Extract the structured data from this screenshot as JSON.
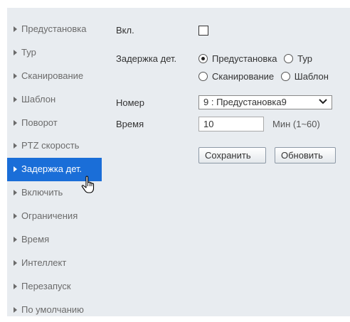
{
  "sidebar": {
    "items": [
      {
        "label": "Предустановка"
      },
      {
        "label": "Тур"
      },
      {
        "label": "Сканирование"
      },
      {
        "label": "Шаблон"
      },
      {
        "label": "Поворот"
      },
      {
        "label": "PTZ скорость"
      },
      {
        "label": "Задержка дет.",
        "active": true
      },
      {
        "label": "Включить"
      },
      {
        "label": "Ограничения"
      },
      {
        "label": "Время"
      },
      {
        "label": "Интеллект"
      },
      {
        "label": "Перезапуск"
      },
      {
        "label": "По умолчанию"
      }
    ],
    "active_color": "#1a6ed8"
  },
  "form": {
    "enable_label": "Вкл.",
    "enable_checked": false,
    "delay_label": "Задержка дет.",
    "options": {
      "preset": "Предустановка",
      "tour": "Тур",
      "scan": "Сканирование",
      "pattern": "Шаблон"
    },
    "selected_option": "preset",
    "number_label": "Номер",
    "number_value": "9 : Предустановка9",
    "time_label": "Время",
    "time_value": "10",
    "time_unit": "Мин (1~60)",
    "save_label": "Сохранить",
    "refresh_label": "Обновить"
  }
}
